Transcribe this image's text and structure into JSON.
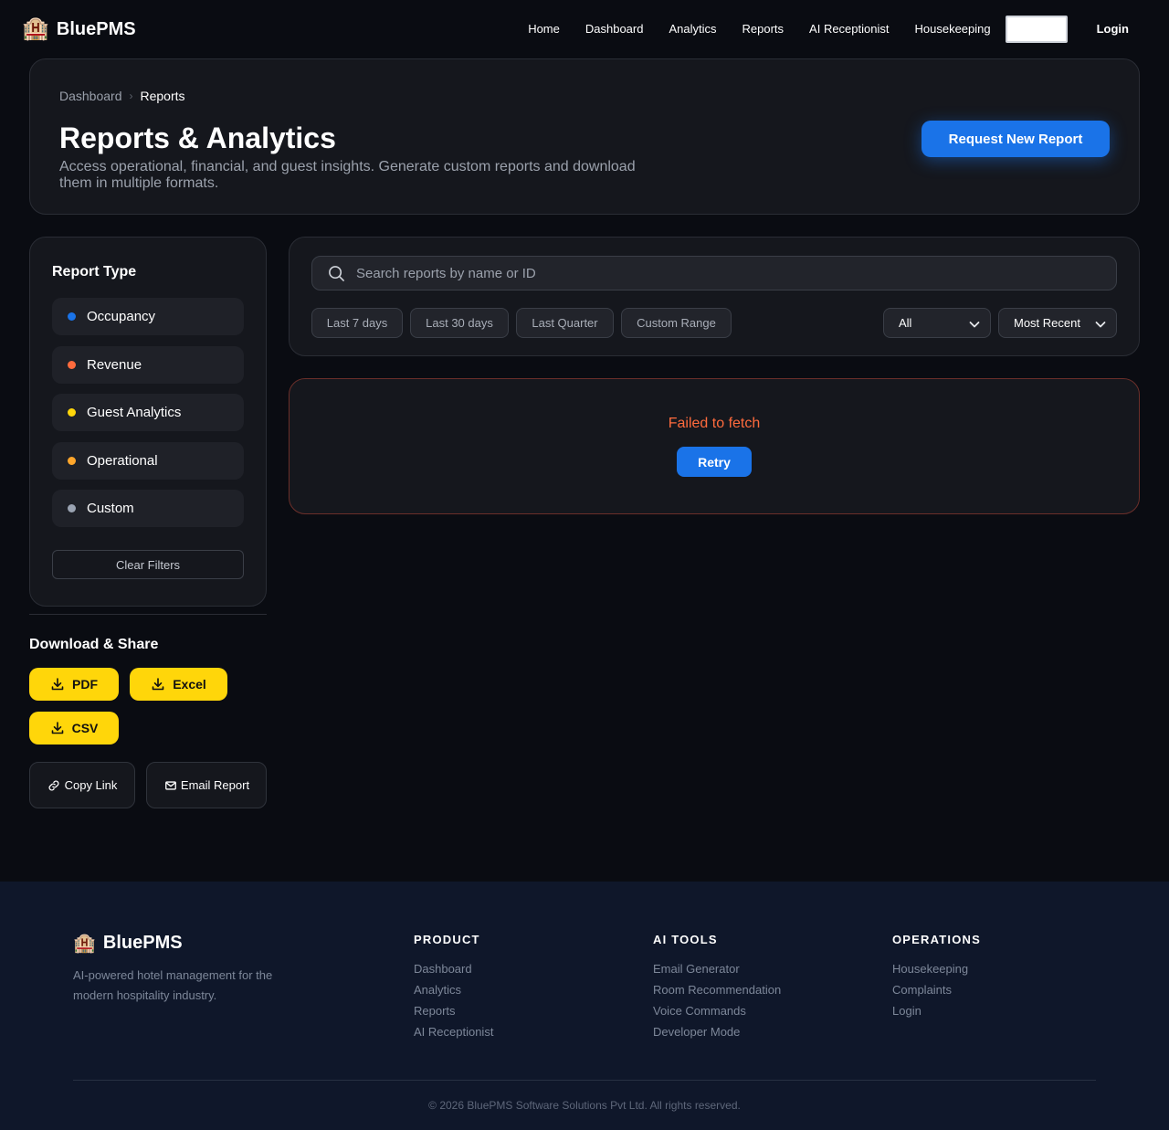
{
  "nav": {
    "brand_icon": "🏨",
    "brand_name": "BluePMS",
    "links": [
      "Home",
      "Dashboard",
      "Analytics",
      "Reports",
      "AI Receptionist",
      "Housekeeping"
    ],
    "login": "Login"
  },
  "header": {
    "breadcrumb": [
      "Dashboard",
      "Reports"
    ],
    "title": "Reports & Analytics",
    "subtitle": "Access operational, financial, and guest insights. Generate custom reports and download them in multiple formats.",
    "request_button": "Request New Report"
  },
  "sidebar": {
    "title": "Report Type",
    "types": [
      {
        "label": "Occupancy",
        "color": "#1a73e8"
      },
      {
        "label": "Revenue",
        "color": "#ff6b3d"
      },
      {
        "label": "Guest Analytics",
        "color": "#ffd60a"
      },
      {
        "label": "Operational",
        "color": "#ffa62b"
      },
      {
        "label": "Custom",
        "color": "#9aa3b2"
      }
    ],
    "clear_filters": "Clear Filters"
  },
  "download": {
    "title": "Download & Share",
    "pdf": "PDF",
    "excel": "Excel",
    "csv": "CSV",
    "copy_link": "Copy Link",
    "email_report": "Email Report"
  },
  "filters": {
    "search_placeholder": "Search reports by name or ID",
    "search_value": "",
    "ranges": [
      "Last 7 days",
      "Last 30 days",
      "Last Quarter",
      "Custom Range"
    ],
    "status_select": "All",
    "sort_select": "Most Recent"
  },
  "error": {
    "message": "Failed to fetch",
    "retry": "Retry"
  },
  "footer": {
    "brand_icon": "🏨",
    "brand_name": "BluePMS",
    "description": "AI-powered hotel management for the modern hospitality industry.",
    "columns": [
      {
        "title": "PRODUCT",
        "links": [
          "Dashboard",
          "Analytics",
          "Reports",
          "AI Receptionist"
        ]
      },
      {
        "title": "AI TOOLS",
        "links": [
          "Email Generator",
          "Room Recommendation",
          "Voice Commands",
          "Developer Mode"
        ]
      },
      {
        "title": "OPERATIONS",
        "links": [
          "Housekeeping",
          "Complaints",
          "Login"
        ]
      }
    ],
    "copyright": "© 2026 BluePMS Software Solutions Pvt Ltd. All rights reserved."
  }
}
